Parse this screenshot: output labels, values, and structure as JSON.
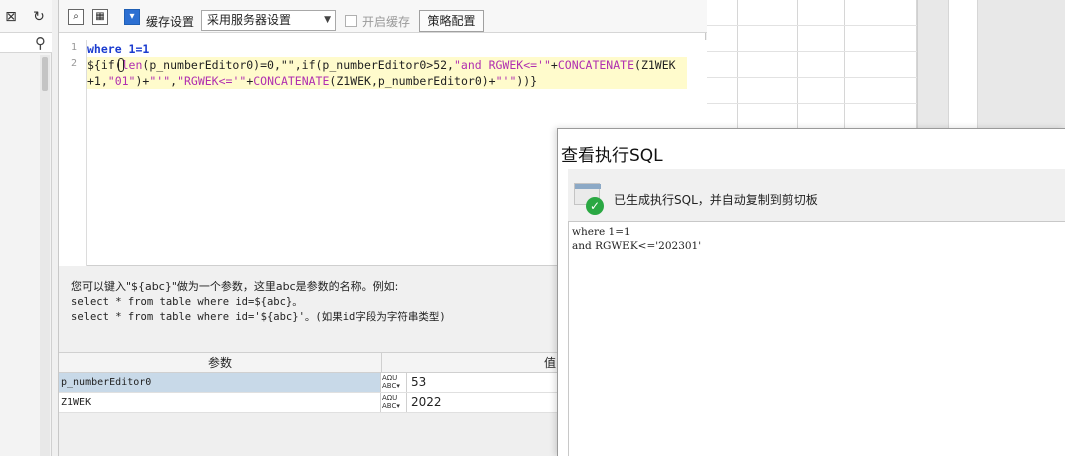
{
  "left_panel": {
    "search_placeholder": ""
  },
  "toolbar": {
    "cache_label": "缓存设置",
    "cache_select_value": "采用服务器设置",
    "enable_cache_label": "开启缓存",
    "strategy_button": "策略配置"
  },
  "editor": {
    "line_numbers": [
      "1",
      "2"
    ],
    "line1": "where 1=1",
    "line2a_prefix": "${if(",
    "line2a_fn": "len",
    "line2a_rest1": "(p_numberEditor0)=0,\"\",if(p_numberEditor0>52,",
    "line2a_str": "\"and RGWEK<='\"",
    "line2a_plus": "+",
    "line2a_fn2": "CONCATENATE",
    "line2a_tail": "(Z1WEK",
    "line2b_head": "+1,",
    "line2b_str1": "\"01\"",
    "line2b_mid1": ")+",
    "line2b_str2": "\"'\"",
    "line2b_mid2": ",",
    "line2b_str3": "\"RGWEK<='\"",
    "line2b_plus": "+",
    "line2b_fn": "CONCATENATE",
    "line2b_mid3": "(Z1WEK,p_numberEditor0)+",
    "line2b_str4": "\"'\"",
    "line2b_end": "))}"
  },
  "help": {
    "line1": "您可以键入\"${abc}\"做为一个参数，这里abc是参数的名称。例如:",
    "line2": "select * from table where id=${abc}。",
    "line3": "select * from table where id='${abc}'。(如果id字段为字符串类型)"
  },
  "params": {
    "header_name": "参数",
    "header_value": "值",
    "type_icon": "abc-type-icon",
    "rows": [
      {
        "name": "p_numberEditor0",
        "type": "AΩU ABC",
        "value": "53"
      },
      {
        "name": "Z1WEK",
        "type": "AΩU ABC",
        "value": "2022"
      }
    ]
  },
  "dialog": {
    "title": "查看执行SQL",
    "message": "已生成执行SQL，并自动复制到剪切板",
    "sql_line1": "where 1=1",
    "sql_line2": "and RGWEK<='202301'",
    "icon": "sql-success-icon"
  },
  "colors": {
    "keyword": "#1b3ccf",
    "function": "#b02fb0",
    "highlight": "#fffbcc",
    "selected_row": "#c8d9e8",
    "success": "#2aa843"
  }
}
